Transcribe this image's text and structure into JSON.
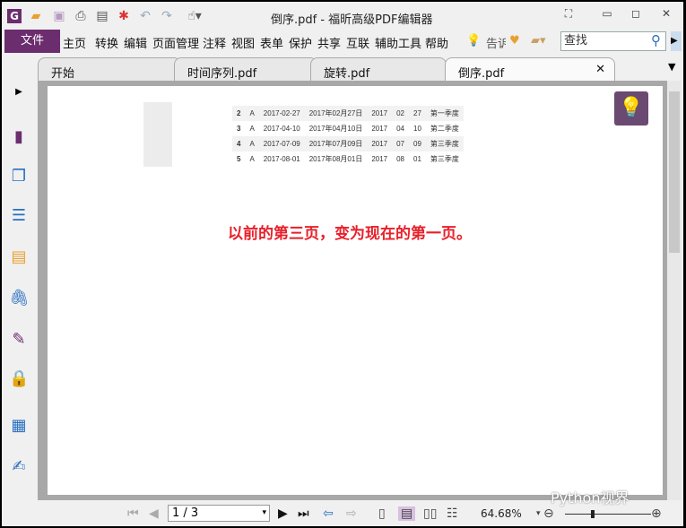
{
  "title": "倒序.pdf - 福昕高级PDF编辑器",
  "menu": {
    "file": "文件",
    "items": [
      "主页",
      "转换",
      "编辑",
      "页面管理",
      "注释",
      "视图",
      "表单",
      "保护",
      "共享",
      "互联",
      "辅助工具",
      "帮助"
    ],
    "tell": "告诉",
    "search_placeholder": "查找"
  },
  "tabs": [
    "开始",
    "时间序列.pdf",
    "旋转.pdf",
    "倒序.pdf"
  ],
  "table": [
    [
      "2",
      "A",
      "2017-02-27",
      "2017年02月27日",
      "2017",
      "02",
      "27",
      "第一季度"
    ],
    [
      "3",
      "A",
      "2017-04-10",
      "2017年04月10日",
      "2017",
      "04",
      "10",
      "第二季度"
    ],
    [
      "4",
      "A",
      "2017-07-09",
      "2017年07月09日",
      "2017",
      "07",
      "09",
      "第三季度"
    ],
    [
      "5",
      "A",
      "2017-08-01",
      "2017年08月01日",
      "2017",
      "08",
      "01",
      "第三季度"
    ]
  ],
  "note": "以前的第三页，变为现在的第一页。",
  "status": {
    "page": "1 / 3",
    "zoom": "64.68%",
    "zoom_level": 0.3
  },
  "watermark": "Python视界",
  "colors": {
    "accent": "#6b2d6e",
    "note": "#e8202a"
  }
}
